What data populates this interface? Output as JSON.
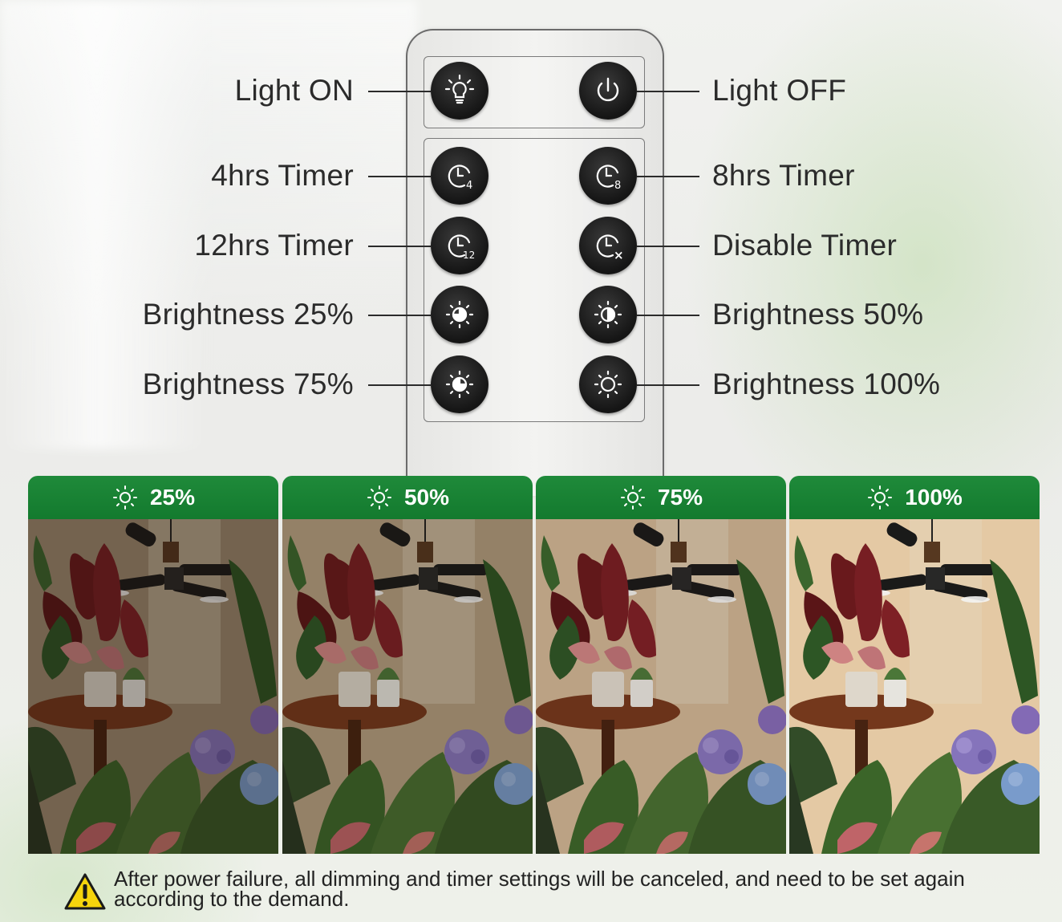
{
  "remote": {
    "buttons": [
      {
        "label": "Light ON",
        "side": "left",
        "icon": "bulb-icon"
      },
      {
        "label": "Light OFF",
        "side": "right",
        "icon": "power-icon"
      },
      {
        "label": "4hrs Timer",
        "side": "left",
        "icon": "clock-icon",
        "badge": "4"
      },
      {
        "label": "8hrs Timer",
        "side": "right",
        "icon": "clock-icon",
        "badge": "8"
      },
      {
        "label": "12hrs Timer",
        "side": "left",
        "icon": "clock-icon",
        "badge": "12"
      },
      {
        "label": "Disable Timer",
        "side": "right",
        "icon": "clock-icon",
        "badge": "×"
      },
      {
        "label": "Brightness 25%",
        "side": "left",
        "icon": "brightness-icon",
        "level": 25
      },
      {
        "label": "Brightness 50%",
        "side": "right",
        "icon": "brightness-icon",
        "level": 50
      },
      {
        "label": "Brightness 75%",
        "side": "left",
        "icon": "brightness-icon",
        "level": 75
      },
      {
        "label": "Brightness 100%",
        "side": "right",
        "icon": "brightness-icon",
        "level": 100
      }
    ]
  },
  "cards": [
    {
      "label": "25%",
      "level": 0.25
    },
    {
      "label": "50%",
      "level": 0.5
    },
    {
      "label": "75%",
      "level": 0.75
    },
    {
      "label": "100%",
      "level": 1.0
    }
  ],
  "notice": {
    "text": "After power failure, all dimming and timer settings will be canceled, and need to be set again according to the demand.",
    "icon": "warning-icon"
  },
  "colors": {
    "header_green": "#1a8436",
    "button_black": "#1c1c1c",
    "warning_yellow": "#f5d40c"
  }
}
